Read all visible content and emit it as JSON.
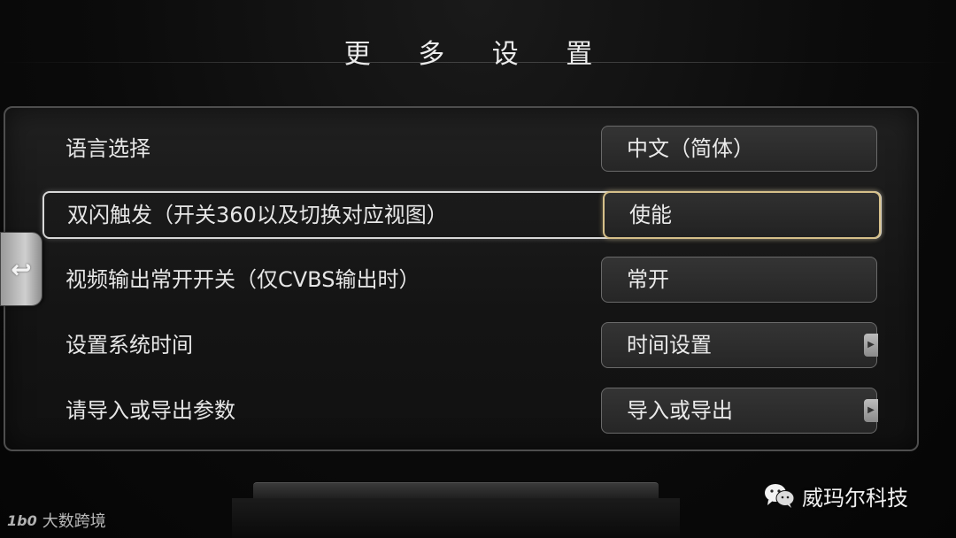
{
  "screen": {
    "title": "更 多 设 置"
  },
  "settings": [
    {
      "label": "语言选择",
      "value": "中文（简体）"
    },
    {
      "label": "双闪触发（开关360以及切换对应视图）",
      "value": "使能"
    },
    {
      "label": "视频输出常开开关（仅CVBS输出时）",
      "value": "常开"
    },
    {
      "label": "设置系统时间",
      "value": "时间设置"
    },
    {
      "label": "请导入或导出参数",
      "value": "导入或导出"
    }
  ],
  "back_button": {
    "icon": "back-arrow-icon"
  },
  "watermarks": {
    "right_text": "威玛尔科技",
    "right_icon": "wechat-icon",
    "left_logo": "1b0",
    "left_text": "大数跨境"
  },
  "colors": {
    "selection_border": "#d6c08a",
    "row_highlight": "#d8d8d8"
  }
}
